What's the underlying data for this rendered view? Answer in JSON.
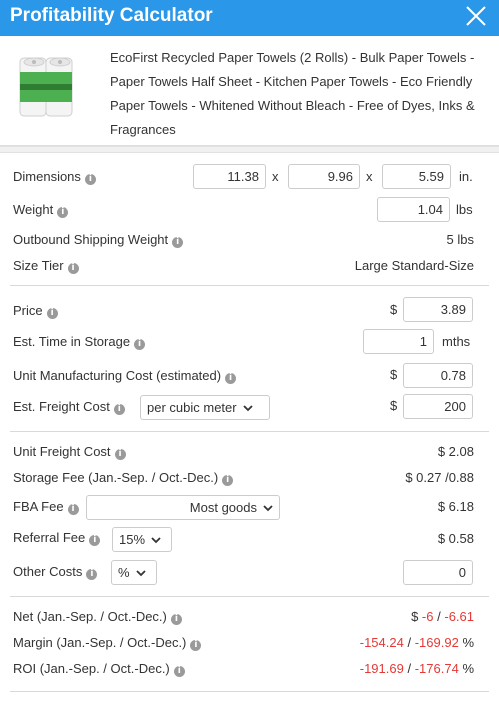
{
  "header": {
    "title": "Profitability Calculator",
    "close_icon": "close-icon"
  },
  "product": {
    "image_icon": "paper-towels-product-image",
    "description": "EcoFirst Recycled Paper Towels (2 Rolls) - Bulk Paper Towels - Paper Towels Half Sheet - Kitchen Paper Towels - Eco Friendly Paper Towels - Whitened Without Bleach - Free of Dyes, Inks & Fragrances"
  },
  "dimensions": {
    "label": "Dimensions",
    "length": "11.38",
    "width": "9.96",
    "height": "5.59",
    "x_sep": "x",
    "unit": "in."
  },
  "weight": {
    "label": "Weight",
    "value": "1.04",
    "unit": "lbs"
  },
  "outbound": {
    "label": "Outbound Shipping Weight",
    "value": "5 lbs"
  },
  "size_tier": {
    "label": "Size Tier",
    "value": "Large Standard-Size"
  },
  "price": {
    "label": "Price",
    "currency": "$",
    "value": "3.89"
  },
  "storage_time": {
    "label": "Est. Time in Storage",
    "value": "1",
    "unit": "mths"
  },
  "manufacturing": {
    "label": "Unit Manufacturing Cost (estimated)",
    "currency": "$",
    "value": "0.78"
  },
  "freight": {
    "label": "Est. Freight Cost",
    "mode": "per cubic meter",
    "currency": "$",
    "value": "200"
  },
  "unit_freight": {
    "label": "Unit Freight Cost",
    "value": "$ 2.08"
  },
  "storage_fee": {
    "label": "Storage Fee (Jan.-Sep. / Oct.-Dec.)",
    "value": "$ 0.27 /0.88"
  },
  "fba_fee": {
    "label": "FBA Fee",
    "category": "Most goods",
    "value": "$ 6.18"
  },
  "referral_fee": {
    "label": "Referral Fee",
    "rate": "15%",
    "value": "$ 0.58"
  },
  "other_costs": {
    "label": "Other Costs",
    "unit": "%",
    "value": "0"
  },
  "net": {
    "label": "Net (Jan.-Sep. / Oct.-Dec.)",
    "prefix": "$",
    "a": "-6",
    "sep": "/",
    "b": "-6.61"
  },
  "margin": {
    "label": "Margin (Jan.-Sep. / Oct.-Dec.)",
    "a": "-154.24",
    "sep": "/",
    "b": "-169.92",
    "suffix": "%"
  },
  "roi": {
    "label": "ROI (Jan.-Sep. / Oct.-Dec.)",
    "a": "-191.69",
    "sep": "/",
    "b": "-176.74",
    "suffix": "%"
  },
  "colors": {
    "header": "#2b97e8",
    "negative": "#e53935",
    "info_icon": "#9a9a9a"
  }
}
